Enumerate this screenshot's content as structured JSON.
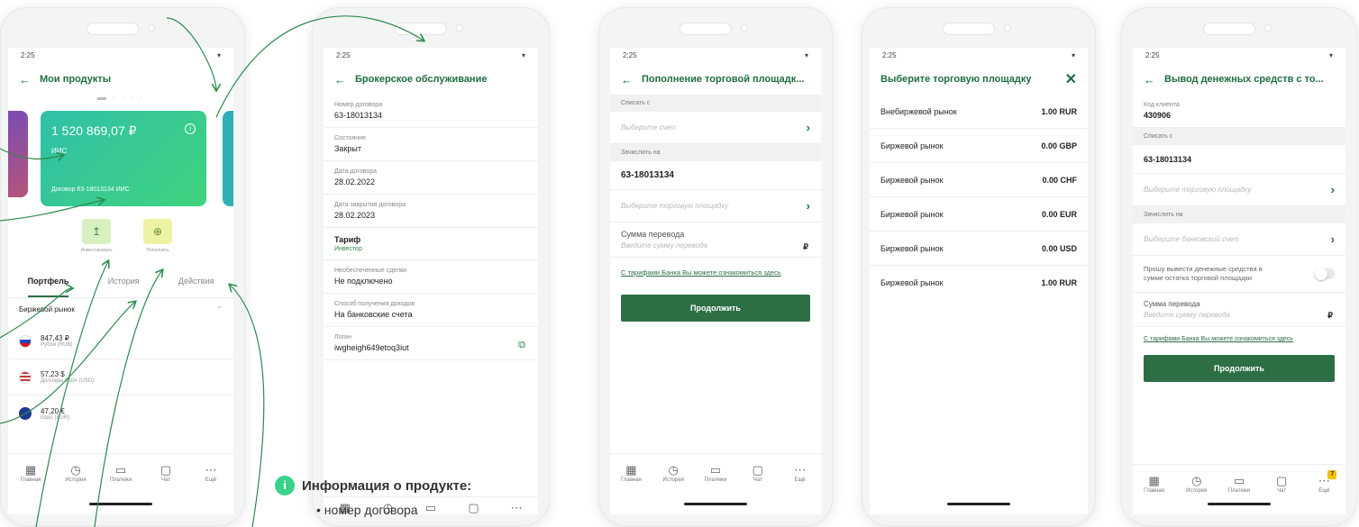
{
  "status_time": "2:25",
  "phone1": {
    "title": "Мои продукты",
    "card_amount": "1 520 869,07 ₽",
    "card_subtitle": "ИИС",
    "card_contract": "Договор 63-18013134 ИИС",
    "action_invest": "Инвестировать",
    "action_topup": "Пополнить",
    "tabs": [
      "Портфель",
      "История",
      "Действия"
    ],
    "market": "Биржевой рынок",
    "assets": [
      {
        "amount": "847,43 ₽",
        "name": "Рубли (RUB)"
      },
      {
        "amount": "57,23 $",
        "name": "Доллары США (USD)"
      },
      {
        "amount": "47,20 €",
        "name": "Евро (EUR)"
      }
    ]
  },
  "phone2": {
    "title": "Брокерское обслуживание",
    "fields": [
      {
        "label": "Номер договора",
        "value": "63-18013134"
      },
      {
        "label": "Состояние",
        "value": "Закрыт"
      },
      {
        "label": "Дата договора",
        "value": "28.02.2022"
      },
      {
        "label": "Дата закрытия договора",
        "value": "28.02.2023"
      },
      {
        "label": "Тариф",
        "value": "Инвестор"
      },
      {
        "label": "Необеспеченные сделки",
        "value": "Не подключено"
      },
      {
        "label": "Способ получения доходов",
        "value": "На банковские счета"
      },
      {
        "label": "Логин",
        "value": "iwgheigh649etoq3iut"
      }
    ]
  },
  "phone3": {
    "title": "Пополнение торговой площадк...",
    "debit_section": "Списать с",
    "debit_placeholder": "Выберите счет",
    "credit_section": "Зачислить на",
    "credit_value": "63-18013134",
    "platform_placeholder": "Выберите торговую площадку",
    "amount_label": "Сумма перевода",
    "amount_placeholder": "Введите сумму перевода",
    "currency": "₽",
    "tariff_link": "С тарифами Банка Вы можете ознакомиться здесь",
    "continue": "Продолжить"
  },
  "phone4": {
    "title": "Выберите торговую площадку",
    "markets": [
      {
        "name": "Внебиржевой рынок",
        "value": "1.00 RUR"
      },
      {
        "name": "Биржевой рынок",
        "value": "0.00 GBP"
      },
      {
        "name": "Биржевой рынок",
        "value": "0.00 CHF"
      },
      {
        "name": "Биржевой рынок",
        "value": "0.00 EUR"
      },
      {
        "name": "Биржевой рынок",
        "value": "0.00 USD"
      },
      {
        "name": "Биржевой рынок",
        "value": "1.00 RUR"
      }
    ]
  },
  "phone5": {
    "title": "Вывод денежных средств с то...",
    "client_label": "Код клиента",
    "client_value": "430906",
    "debit_section": "Списать с",
    "debit_value": "63-18013134",
    "platform_placeholder": "Выберите торговую площадку",
    "credit_section": "Зачислить на",
    "account_placeholder": "Выберите банковский счет",
    "withdraw_all": "Прошу вывести денежные средства в сумме остатка торговой площадки",
    "amount_label": "Сумма перевода",
    "amount_placeholder": "Введите сумму перевода",
    "currency": "₽",
    "tariff_link": "С тарифами Банка Вы можете ознакомиться здесь",
    "continue": "Продолжить",
    "badge": "7"
  },
  "tabbar": [
    "Главная",
    "История",
    "Платежи",
    "Чат",
    "Ещё"
  ],
  "info": {
    "title": "Информация о продукте:",
    "item": "номер договора"
  }
}
